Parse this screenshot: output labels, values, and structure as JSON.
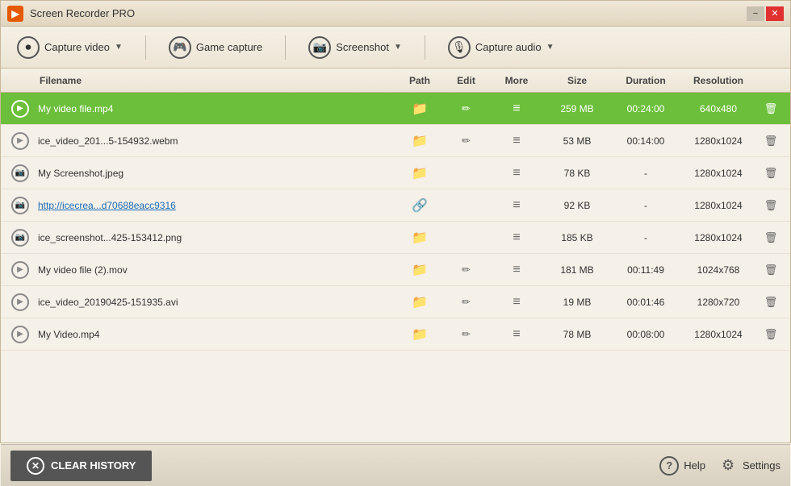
{
  "app": {
    "title": "Screen Recorder PRO"
  },
  "window_controls": {
    "minimize": "−",
    "close": "✕"
  },
  "toolbar": {
    "capture_video_label": "Capture video",
    "game_capture_label": "Game capture",
    "screenshot_label": "Screenshot",
    "capture_audio_label": "Capture audio"
  },
  "columns": {
    "icon": "",
    "filename": "Filename",
    "path": "Path",
    "edit": "Edit",
    "more": "More",
    "size": "Size",
    "duration": "Duration",
    "resolution": "Resolution",
    "delete": ""
  },
  "rows": [
    {
      "type": "video",
      "selected": true,
      "filename": "My video file.mp4",
      "path": "📁",
      "edit": "✏",
      "more": "≡",
      "size": "259 MB",
      "duration": "00:24:00",
      "resolution": "640x480",
      "is_link": false
    },
    {
      "type": "video",
      "selected": false,
      "filename": "ice_video_201...5-154932.webm",
      "path": "📁",
      "edit": "✏",
      "more": "≡",
      "size": "53 MB",
      "duration": "00:14:00",
      "resolution": "1280x1024",
      "is_link": false
    },
    {
      "type": "screenshot",
      "selected": false,
      "filename": "My Screenshot.jpeg",
      "path": "📁",
      "edit": "",
      "more": "≡",
      "size": "78 KB",
      "duration": "-",
      "resolution": "1280x1024",
      "is_link": false
    },
    {
      "type": "screenshot",
      "selected": false,
      "filename": "http://icecrea...d70688eacc9316",
      "path": "🔗",
      "edit": "",
      "more": "≡",
      "size": "92 KB",
      "duration": "-",
      "resolution": "1280x1024",
      "is_link": true
    },
    {
      "type": "screenshot",
      "selected": false,
      "filename": "ice_screenshot...425-153412.png",
      "path": "📁",
      "edit": "",
      "more": "≡",
      "size": "185 KB",
      "duration": "-",
      "resolution": "1280x1024",
      "is_link": false
    },
    {
      "type": "video",
      "selected": false,
      "filename": "My video file (2).mov",
      "path": "📁",
      "edit": "✏",
      "more": "≡",
      "size": "181 MB",
      "duration": "00:11:49",
      "resolution": "1024x768",
      "is_link": false
    },
    {
      "type": "video",
      "selected": false,
      "filename": "ice_video_20190425-151935.avi",
      "path": "📁",
      "edit": "✏",
      "more": "≡",
      "size": "19 MB",
      "duration": "00:01:46",
      "resolution": "1280x720",
      "is_link": false
    },
    {
      "type": "video",
      "selected": false,
      "filename": "My Video.mp4",
      "path": "📁",
      "edit": "✏",
      "more": "≡",
      "size": "78 MB",
      "duration": "00:08:00",
      "resolution": "1280x1024",
      "is_link": false
    }
  ],
  "bottom": {
    "clear_history_label": "CLEAR HISTORY",
    "help_label": "Help",
    "settings_label": "Settings"
  },
  "colors": {
    "selected_row_bg": "#6cbf3a",
    "accent_orange": "#e55a00"
  }
}
